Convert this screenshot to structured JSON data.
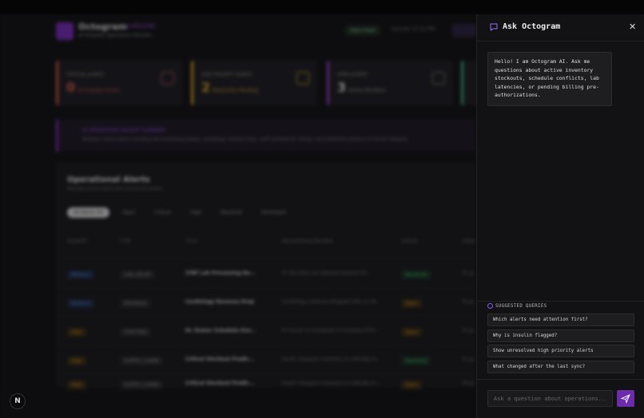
{
  "background": {
    "header": {
      "app_name": "Octogram",
      "badge": "CARESYNC",
      "subtitle": "AI Hospital Operations Monitor",
      "data_fresh": "Data Fresh",
      "last_sync": "Synced: 07:31 PM"
    },
    "cards": [
      {
        "label": "CRITICAL ALERTS",
        "count": "0",
        "text": "Immediate Action",
        "color": "#e0564f"
      },
      {
        "label": "HIGH PRIORITY ALERTS",
        "count": "2",
        "text": "Resolution Pending",
        "color": "#e5a524"
      },
      {
        "label": "OPEN ALERTS",
        "count": "3",
        "text": "Active Monitors",
        "color": "#9b3fd1"
      }
    ],
    "banner": {
      "title": "AI OPERATIONS INSIGHT SUMMARY",
      "text": "Multiple critical alerts including lab processing delays, cardiology revenue drop, staff overload Dr. Kumar, and predicted stockout of Insulin Glargine."
    },
    "panel": {
      "title": "Operational Alerts",
      "subtitle": "Manage active alerts and resolve AI actions",
      "tabs": [
        "All Alerts (5)",
        "Open",
        "Critical",
        "High",
        "Resolved",
        "Dismissed"
      ],
      "columns": [
        "SEVERITY",
        "TYPE",
        "TITLE",
        "DESCRIPTION PREVIEW",
        "STATUS",
        "CREAT"
      ],
      "rows": [
        {
          "severity": "Medium",
          "type": "LAB_DELAY",
          "title": "STAT Lab Processing De...",
          "desc": "47 lab tests are delayed beyond 2h...",
          "status": "Resolved",
          "created": "31 Ja"
        },
        {
          "severity": "Medium",
          "type": "REVENUE",
          "title": "Cardiology Revenue Drop",
          "desc": "Cardiology revenue dropped 18% vs 30...",
          "status": "Open",
          "created": "31 Ja"
        },
        {
          "severity": "High",
          "type": "STAFFING",
          "title": "Dr. Kumar Schedule Ove...",
          "desc": "Dr Kumar is scheduled 14 hrs/day 07/0...",
          "status": "Open",
          "created": "31 Ja"
        },
        {
          "severity": "High",
          "type": "SUPPLY_CHAIN",
          "title": "Critical Stockout Predic...",
          "desc": "Insulin Glargine inventory is critically lo...",
          "status": "Resolved",
          "created": "31 Ja"
        },
        {
          "severity": "High",
          "type": "SUPPLY_CHAIN",
          "title": "Critical Stockout Predic...",
          "desc": "Insulin Glargine inventory is critically lo...",
          "status": "Open",
          "created": "30 Ja"
        }
      ]
    },
    "fab_letter": "N"
  },
  "sidebar": {
    "title": "Ask Octogram",
    "greeting": "Hello! I am Octogram AI. Ask me questions about active inventory stockouts, schedule conflicts, lab latencies, or pending billing pre-authorizations.",
    "suggested_label": "SUGGESTED QUERIES",
    "suggestions": [
      "Which alerts need attention first?",
      "Why is insulin flagged?",
      "Show unresolved high priority alerts",
      "What changed after the last sync?"
    ],
    "input_placeholder": "Ask a question about operations...",
    "input_value": "",
    "accent": "#6b2bab"
  }
}
